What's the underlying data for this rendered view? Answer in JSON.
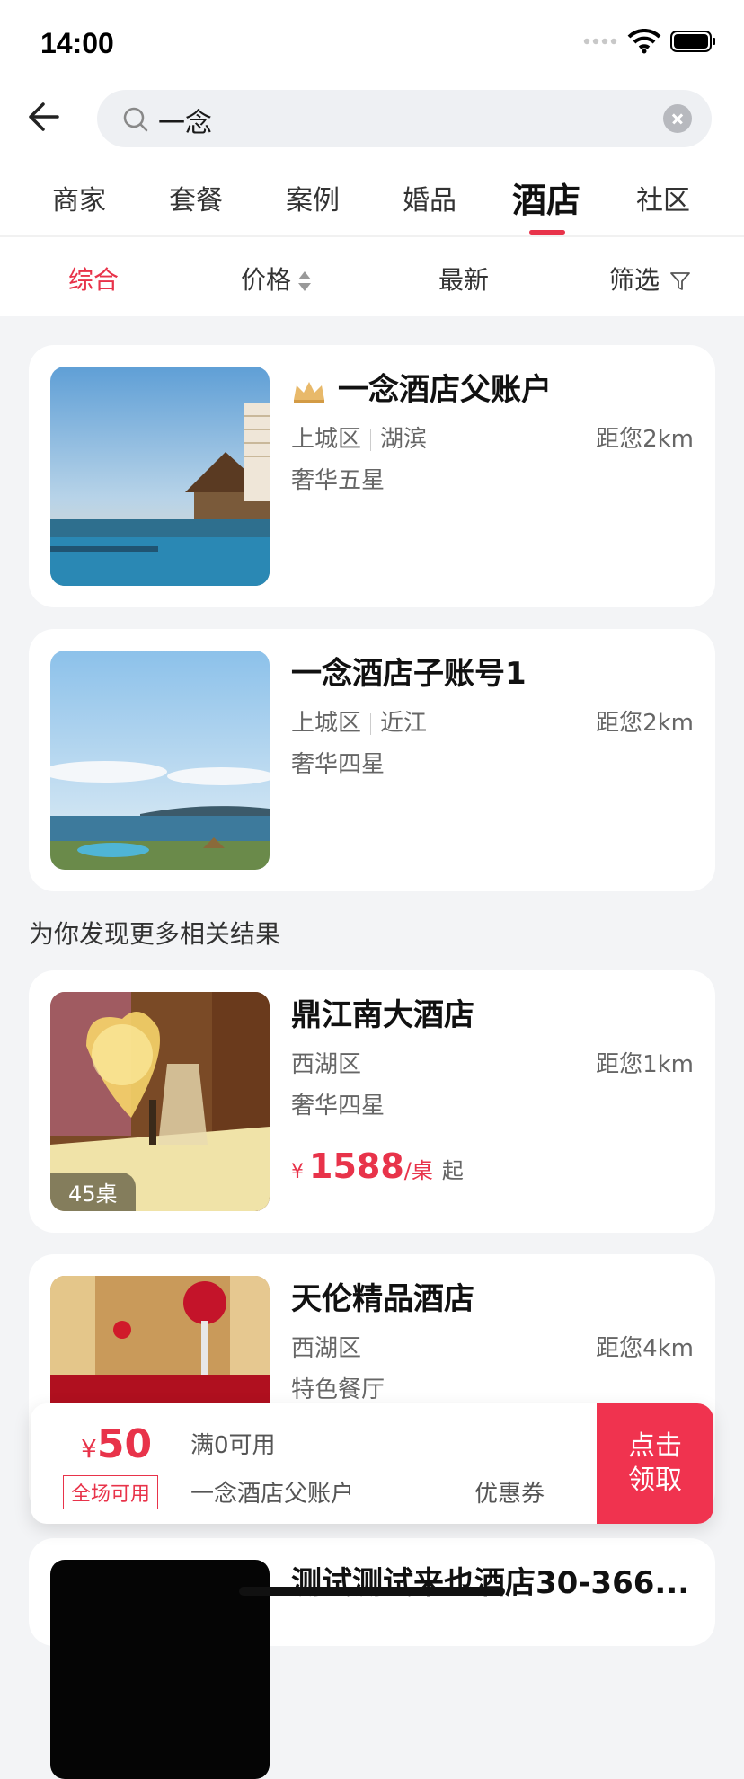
{
  "status_bar": {
    "time": "14:00"
  },
  "search": {
    "query": "一念"
  },
  "tabs": [
    {
      "label": "商家"
    },
    {
      "label": "套餐"
    },
    {
      "label": "案例"
    },
    {
      "label": "婚品"
    },
    {
      "label": "酒店",
      "active": true
    },
    {
      "label": "社区"
    }
  ],
  "sort": {
    "comprehensive": "综合",
    "price": "价格",
    "latest": "最新",
    "filter": "筛选"
  },
  "results": [
    {
      "name": "一念酒店父账户",
      "district": "上城区",
      "area": "湖滨",
      "distance": "距您2km",
      "level": "奢华五星",
      "crown": true
    },
    {
      "name": "一念酒店子账号1",
      "district": "上城区",
      "area": "近江",
      "distance": "距您2km",
      "level": "奢华四星"
    }
  ],
  "more_label": "为你发现更多相关结果",
  "more_results": [
    {
      "name": "鼎江南大酒店",
      "district": "西湖区",
      "distance": "距您1km",
      "level": "奢华四星",
      "tables": "45桌",
      "price_symbol": "¥",
      "price": "1588",
      "price_unit": "/桌",
      "price_suffix": "起"
    },
    {
      "name": "天伦精品酒店",
      "district": "西湖区",
      "distance": "距您4km",
      "level": "特色餐厅"
    },
    {
      "name": "测试测试来也酒店30-366..."
    }
  ],
  "coupon": {
    "symbol": "¥",
    "amount": "50",
    "scope": "全场可用",
    "condition": "满0可用",
    "shop": "一念酒店父账户",
    "type": "优惠券",
    "claim_line1": "点击",
    "claim_line2": "领取"
  },
  "colors": {
    "accent": "#e8334a",
    "background": "#f3f4f6"
  }
}
